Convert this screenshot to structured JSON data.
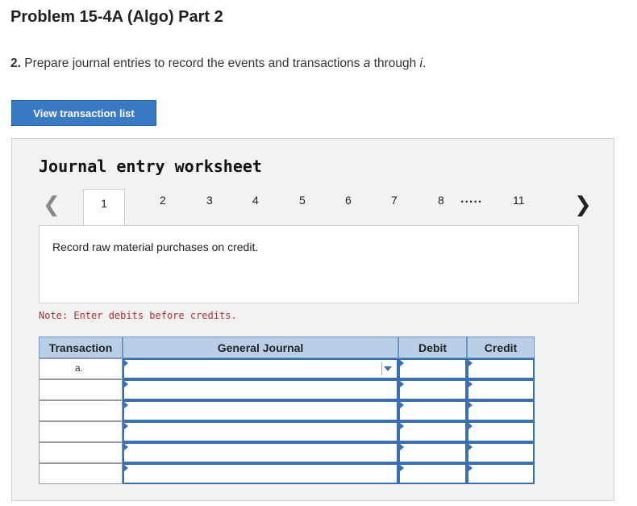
{
  "page": {
    "title": "Problem 15-4A (Algo) Part 2",
    "instruction_num": "2.",
    "instruction_text": " Prepare journal entries to record the events and transactions ",
    "instruction_a": "a",
    "instruction_mid": " through ",
    "instruction_i": "i",
    "instruction_end": "."
  },
  "view_button": {
    "label": "View transaction list"
  },
  "worksheet": {
    "title": "Journal entry worksheet",
    "tabs": [
      "1",
      "2",
      "3",
      "4",
      "5",
      "6",
      "7",
      "8",
      "11"
    ],
    "active_tab": "1",
    "ellipsis": ".....",
    "prev_icon": "chevron-left-icon",
    "next_icon": "chevron-right-icon",
    "description": "Record raw material purchases on credit.",
    "note": "Note: Enter debits before credits."
  },
  "journal": {
    "headers": {
      "transaction": "Transaction",
      "general_journal": "General Journal",
      "debit": "Debit",
      "credit": "Credit"
    },
    "rows": [
      {
        "transaction": "a.",
        "account": "",
        "debit": "",
        "credit": ""
      },
      {
        "transaction": "",
        "account": "",
        "debit": "",
        "credit": ""
      },
      {
        "transaction": "",
        "account": "",
        "debit": "",
        "credit": ""
      },
      {
        "transaction": "",
        "account": "",
        "debit": "",
        "credit": ""
      },
      {
        "transaction": "",
        "account": "",
        "debit": "",
        "credit": ""
      },
      {
        "transaction": "",
        "account": "",
        "debit": "",
        "credit": ""
      }
    ]
  },
  "colors": {
    "accent": "#3a79c4",
    "header_bg": "#b9cfe8",
    "note": "#b03030"
  }
}
